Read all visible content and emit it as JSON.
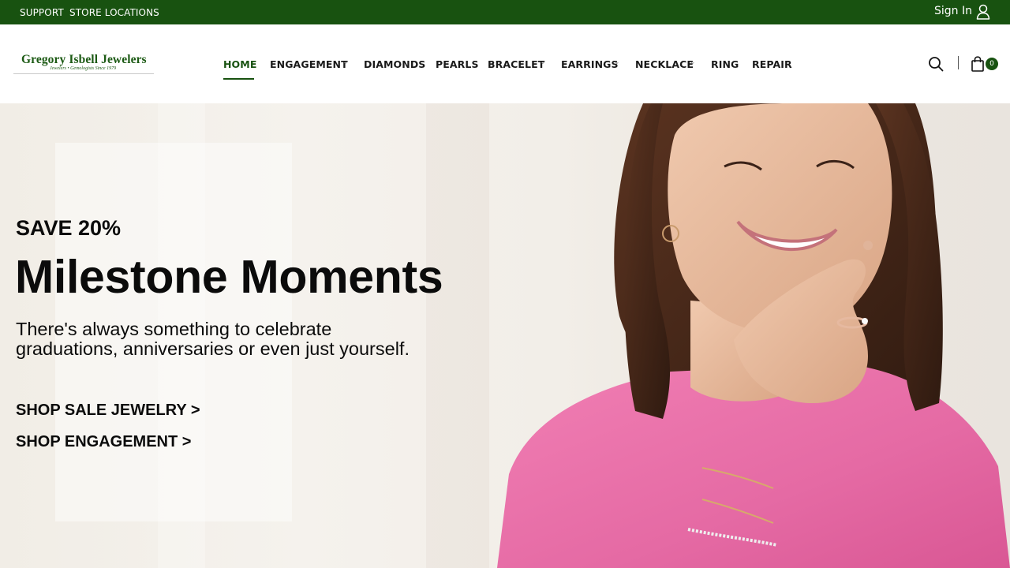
{
  "topbar": {
    "links": [
      "SUPPORT",
      "STORE LOCATIONS"
    ],
    "sign_in": "Sign In"
  },
  "brand": {
    "name": "Gregory Isbell Jewelers",
    "tagline": "Jewelers • Gemologists Since 1979",
    "color": "#185210"
  },
  "nav": {
    "items": [
      {
        "label": "HOME",
        "active": true
      },
      {
        "label": "ENGAGEMENT",
        "dropdown": true
      },
      {
        "label": "DIAMONDS"
      },
      {
        "label": "PEARLS"
      },
      {
        "label": "BRACELET",
        "dropdown": true
      },
      {
        "label": "EARRINGS",
        "dropdown": true
      },
      {
        "label": "NECKLACE",
        "dropdown": true
      },
      {
        "label": "RING"
      },
      {
        "label": "REPAIR"
      }
    ],
    "caret": "⌄"
  },
  "cart": {
    "count": "0"
  },
  "hero": {
    "eyebrow": "SAVE 20%",
    "headline": "Milestone Moments",
    "subtext_line1": "There's always something to celebrate",
    "subtext_line2": "graduations, anniversaries or even just yourself.",
    "cta_sale": "SHOP SALE JEWELRY >",
    "cta_engagement": "SHOP ENGAGEMENT >"
  }
}
